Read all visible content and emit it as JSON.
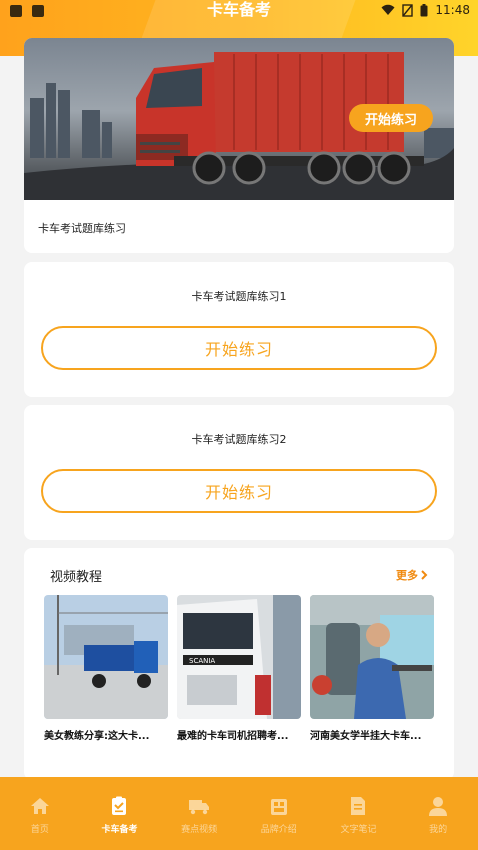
{
  "status_bar": {
    "time": "11:48"
  },
  "header": {
    "title": "卡车备考"
  },
  "hero": {
    "caption": "卡车考试题库练习",
    "button_label": "开始练习"
  },
  "practices": [
    {
      "title": "卡车考试题库练习1",
      "button_label": "开始练习"
    },
    {
      "title": "卡车考试题库练习2",
      "button_label": "开始练习"
    }
  ],
  "videos": {
    "heading": "视频教程",
    "more_label": "更多",
    "items": [
      {
        "caption": "美女教练分享:这大卡..."
      },
      {
        "caption": "最难的卡车司机招聘考..."
      },
      {
        "caption": "河南美女学半挂大卡车..."
      }
    ]
  },
  "tabs": [
    {
      "label": "首页",
      "icon": "home-icon",
      "active": false
    },
    {
      "label": "卡车备考",
      "icon": "checklist-icon",
      "active": true
    },
    {
      "label": "赛点视频",
      "icon": "truck-icon",
      "active": false
    },
    {
      "label": "品牌介绍",
      "icon": "building-icon",
      "active": false
    },
    {
      "label": "文字笔记",
      "icon": "note-icon",
      "active": false
    },
    {
      "label": "我的",
      "icon": "user-icon",
      "active": false
    }
  ],
  "colors": {
    "accent": "#f7a41e",
    "header_gradient_start": "#ffa21c",
    "header_gradient_end": "#ffd42a"
  }
}
